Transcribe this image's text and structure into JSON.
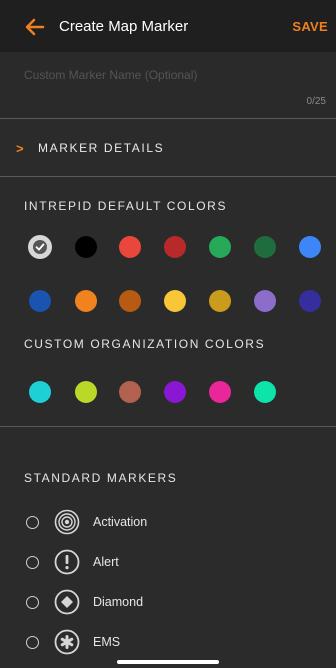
{
  "header": {
    "title": "Create Map Marker",
    "save_label": "SAVE"
  },
  "name_field": {
    "placeholder": "Custom Marker Name (Optional)",
    "counter": "0/25"
  },
  "details": {
    "label": "MARKER DETAILS",
    "chevron": ">"
  },
  "default_colors": {
    "label": "INTREPID DEFAULT COLORS",
    "colors": [
      "#555555",
      "#000000",
      "#e9473c",
      "#b82a2a",
      "#27a95a",
      "#1f6d3e",
      "#3d86f7",
      "#1b53b0",
      "#f08220",
      "#b95a12",
      "#f8c637",
      "#c99c1c",
      "#8c6dc9",
      "#352e9c"
    ],
    "selected_index": 0
  },
  "custom_colors": {
    "label": "CUSTOM ORGANIZATION COLORS",
    "colors": [
      "#1cd0d6",
      "#bad827",
      "#b36150",
      "#8a17d4",
      "#ea269b",
      "#0ee3aa"
    ]
  },
  "standard_markers": {
    "label": "STANDARD MARKERS",
    "items": [
      {
        "label": "Activation",
        "icon": "activation-icon"
      },
      {
        "label": "Alert",
        "icon": "alert-icon"
      },
      {
        "label": "Diamond",
        "icon": "diamond-icon"
      },
      {
        "label": "EMS",
        "icon": "ems-icon"
      }
    ]
  },
  "colors": {
    "accent": "#f0801e",
    "background": "#2b2b2b",
    "header_bg": "#1f1f1f"
  }
}
